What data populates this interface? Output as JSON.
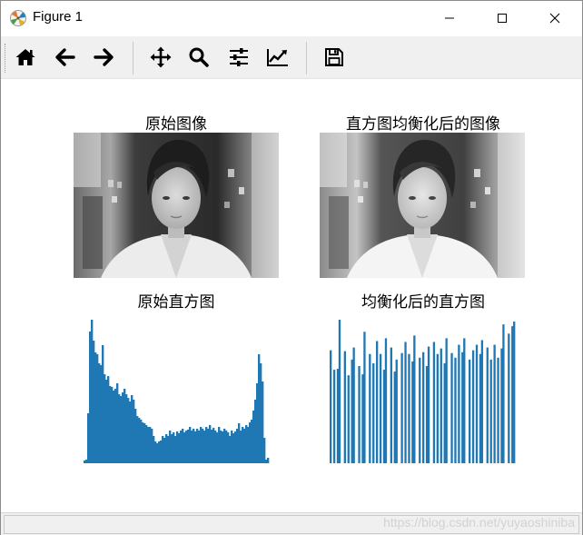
{
  "window": {
    "title": "Figure 1",
    "controls": [
      "minimize",
      "maximize",
      "close"
    ]
  },
  "toolbar": {
    "buttons": [
      {
        "icon": "home-icon",
        "tooltip": "Home"
      },
      {
        "icon": "back-arrow-icon",
        "tooltip": "Back"
      },
      {
        "icon": "forward-arrow-icon",
        "tooltip": "Forward"
      },
      {
        "icon": "pan-icon",
        "tooltip": "Pan"
      },
      {
        "icon": "zoom-icon",
        "tooltip": "Zoom"
      },
      {
        "icon": "subplots-icon",
        "tooltip": "Subplots"
      },
      {
        "icon": "edit-curves-icon",
        "tooltip": "Customize"
      },
      {
        "icon": "save-icon",
        "tooltip": "Save"
      }
    ]
  },
  "figure": {
    "subplots": [
      {
        "title": "原始图像"
      },
      {
        "title": "直方图均衡化后的图像"
      },
      {
        "title": "原始直方图"
      },
      {
        "title": "均衡化后的直方图"
      }
    ]
  },
  "chart_data": [
    {
      "type": "bar",
      "title": "原始直方图",
      "color": "#1f77b4",
      "values": [
        3,
        4,
        55,
        145,
        158,
        135,
        122,
        120,
        110,
        108,
        130,
        98,
        92,
        96,
        85,
        84,
        80,
        82,
        88,
        76,
        74,
        78,
        82,
        76,
        72,
        68,
        75,
        70,
        60,
        52,
        50,
        48,
        45,
        44,
        42,
        40,
        40,
        38,
        30,
        24,
        22,
        24,
        25,
        30,
        28,
        32,
        30,
        36,
        32,
        34,
        30,
        35,
        33,
        36,
        38,
        34,
        36,
        37,
        40,
        36,
        38,
        35,
        38,
        36,
        40,
        38,
        36,
        40,
        38,
        42,
        37,
        39,
        36,
        34,
        40,
        36,
        35,
        38,
        36,
        34,
        30,
        36,
        33,
        35,
        38,
        44,
        36,
        40,
        38,
        42,
        40,
        45,
        48,
        58,
        70,
        88,
        120,
        110,
        90,
        28,
        4,
        6
      ]
    },
    {
      "type": "bar",
      "title": "均衡化后的直方图",
      "color": "#1f77b4",
      "values": [
        122,
        0,
        101,
        0,
        102,
        155,
        0,
        0,
        121,
        0,
        95,
        0,
        112,
        125,
        0,
        0,
        105,
        0,
        96,
        142,
        0,
        0,
        118,
        0,
        108,
        0,
        132,
        0,
        118,
        0,
        101,
        135,
        0,
        0,
        125,
        0,
        99,
        112,
        0,
        0,
        119,
        0,
        131,
        0,
        118,
        0,
        110,
        138,
        0,
        0,
        114,
        0,
        120,
        0,
        105,
        126,
        0,
        0,
        131,
        0,
        118,
        0,
        124,
        0,
        108,
        135,
        0,
        0,
        119,
        0,
        114,
        0,
        128,
        0,
        120,
        135,
        0,
        0,
        112,
        0,
        122,
        0,
        128,
        0,
        118,
        133,
        0,
        0,
        125,
        0,
        112,
        0,
        128,
        0,
        114,
        0,
        124,
        150,
        0,
        0,
        140,
        0,
        148,
        153
      ]
    }
  ],
  "watermark": "https://blog.csdn.net/yuyaoshiniba"
}
